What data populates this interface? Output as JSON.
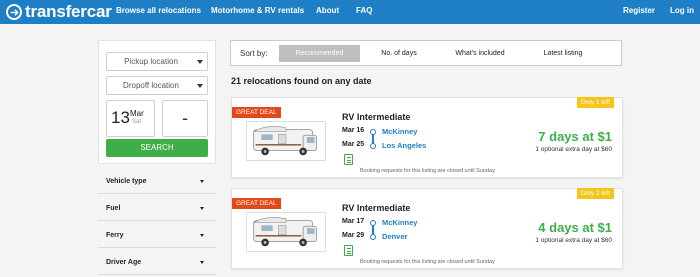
{
  "brand": {
    "name": "transfercar"
  },
  "nav": {
    "links": [
      "Browse all relocations",
      "Motorhome & RV rentals",
      "About",
      "FAQ"
    ],
    "register": "Register",
    "login": "Log in"
  },
  "search": {
    "pickup": "Pickup location",
    "dropoff": "Dropoff location",
    "date_day": "13",
    "date_month": "Mar",
    "date_weekday": "Sat",
    "end_placeholder": "-",
    "button": "SEARCH"
  },
  "filters": [
    "Vehicle type",
    "Fuel",
    "Ferry",
    "Driver Age"
  ],
  "sort": {
    "label": "Sort by:",
    "options": [
      "Recommended",
      "No. of days",
      "What's included",
      "Latest listing"
    ],
    "active": "Recommended"
  },
  "results_count": "21 relocations found on any date",
  "listings": [
    {
      "badge": "GREAT DEAL",
      "title": "RV Intermediate",
      "from_date": "Mar 16",
      "to_date": "Mar 25",
      "from_location": "McKinney",
      "to_location": "Los Angeles",
      "notice": "Booking requests for this listing are closed until Sunday",
      "availability": "Only 1 left",
      "price": "7 days at $1",
      "extra": "1 optional extra day at $60"
    },
    {
      "badge": "GREAT DEAL",
      "title": "RV Intermediate",
      "from_date": "Mar 17",
      "to_date": "Mar 29",
      "from_location": "McKinney",
      "to_location": "Denver",
      "notice": "Booking requests for this listing are closed until Sunday",
      "availability": "Only 2 left",
      "price": "4 days at $1",
      "extra": "1 optional extra day at $60"
    }
  ],
  "colors": {
    "nav_bg": "#1f7fc6",
    "accent_green": "#3fae49",
    "deal_badge": "#e24a1c",
    "availability_badge": "#f5c518",
    "link_blue": "#1f7fc6"
  }
}
